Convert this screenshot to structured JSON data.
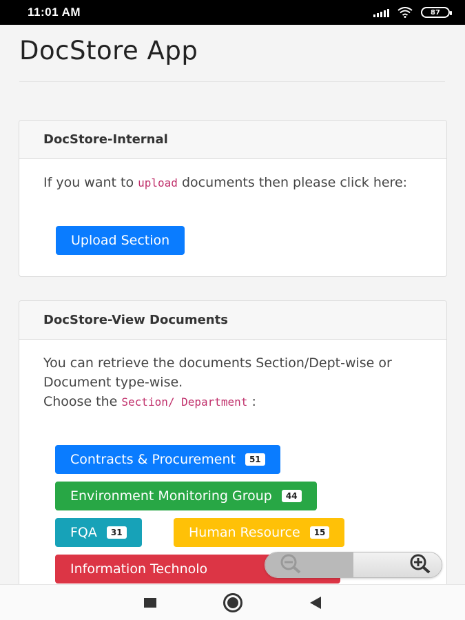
{
  "status_bar": {
    "time": "11:01 AM",
    "battery": "87"
  },
  "page": {
    "title": "DocStore App"
  },
  "internal_card": {
    "header": "DocStore-Internal",
    "text_before": "If you want to ",
    "code": "upload",
    "text_after": " documents then please click here:",
    "upload_button": "Upload Section"
  },
  "view_card": {
    "header": "DocStore-View Documents",
    "text": "You can retrieve the documents Section/Dept-wise or Document type-wise.",
    "choose_text": "Choose the ",
    "choose_code": "Section/ Department",
    "choose_suffix": " :",
    "departments": [
      {
        "label": "Contracts & Procurement",
        "count": "51",
        "color": "#0a7cff"
      },
      {
        "label": "Environment Monitoring Group",
        "count": "44",
        "color": "#28a745"
      },
      {
        "label": "FQA",
        "count": "31",
        "color": "#17a2b8"
      },
      {
        "label": "Human Resource",
        "count": "15",
        "color": "#ffc107"
      },
      {
        "label": "Information Technolo",
        "count": "",
        "color": "#dc3545"
      }
    ]
  },
  "zoom": {
    "out_icon": "zoom-out-icon",
    "in_icon": "zoom-in-icon"
  }
}
